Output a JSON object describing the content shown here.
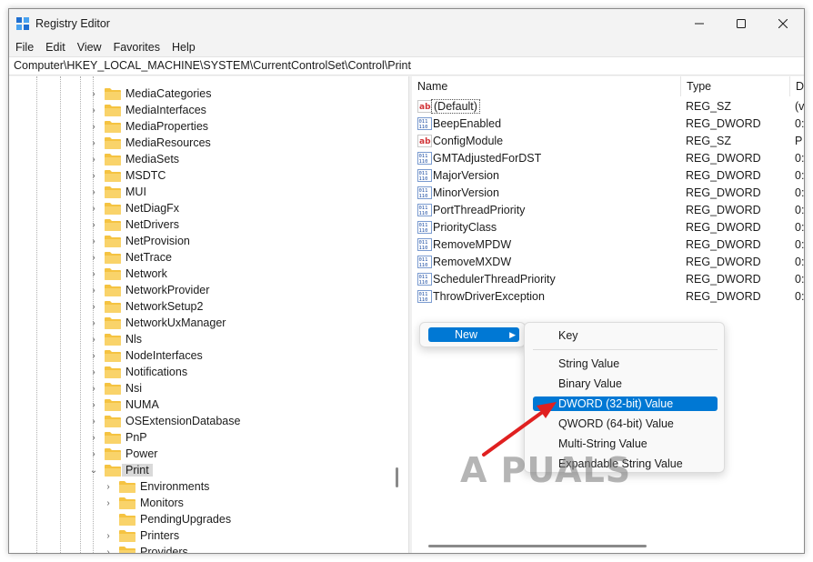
{
  "window": {
    "title": "Registry Editor"
  },
  "menu": [
    "File",
    "Edit",
    "View",
    "Favorites",
    "Help"
  ],
  "address": "Computer\\HKEY_LOCAL_MACHINE\\SYSTEM\\CurrentControlSet\\Control\\Print",
  "tree": {
    "items": [
      "MediaCategories",
      "MediaInterfaces",
      "MediaProperties",
      "MediaResources",
      "MediaSets",
      "MSDTC",
      "MUI",
      "NetDiagFx",
      "NetDrivers",
      "NetProvision",
      "NetTrace",
      "Network",
      "NetworkProvider",
      "NetworkSetup2",
      "NetworkUxManager",
      "Nls",
      "NodeInterfaces",
      "Notifications",
      "Nsi",
      "NUMA",
      "OSExtensionDatabase",
      "PnP",
      "Power",
      "Print"
    ],
    "selected": "Print",
    "children": [
      "Environments",
      "Monitors",
      "PendingUpgrades",
      "Printers",
      "Providers"
    ]
  },
  "list": {
    "columns": [
      "Name",
      "Type",
      "Data"
    ],
    "rows": [
      {
        "name": "(Default)",
        "type": "REG_SZ",
        "data": "(v",
        "icon": "string-value-icon"
      },
      {
        "name": "BeepEnabled",
        "type": "REG_DWORD",
        "data": "0:",
        "icon": "binary-value-icon"
      },
      {
        "name": "ConfigModule",
        "type": "REG_SZ",
        "data": "P",
        "icon": "string-value-icon"
      },
      {
        "name": "GMTAdjustedForDST",
        "type": "REG_DWORD",
        "data": "0:",
        "icon": "binary-value-icon"
      },
      {
        "name": "MajorVersion",
        "type": "REG_DWORD",
        "data": "0:",
        "icon": "binary-value-icon"
      },
      {
        "name": "MinorVersion",
        "type": "REG_DWORD",
        "data": "0:",
        "icon": "binary-value-icon"
      },
      {
        "name": "PortThreadPriority",
        "type": "REG_DWORD",
        "data": "0:",
        "icon": "binary-value-icon"
      },
      {
        "name": "PriorityClass",
        "type": "REG_DWORD",
        "data": "0:",
        "icon": "binary-value-icon"
      },
      {
        "name": "RemoveMPDW",
        "type": "REG_DWORD",
        "data": "0:",
        "icon": "binary-value-icon"
      },
      {
        "name": "RemoveMXDW",
        "type": "REG_DWORD",
        "data": "0:",
        "icon": "binary-value-icon"
      },
      {
        "name": "SchedulerThreadPriority",
        "type": "REG_DWORD",
        "data": "0:",
        "icon": "binary-value-icon"
      },
      {
        "name": "ThrowDriverException",
        "type": "REG_DWORD",
        "data": "0:",
        "icon": "binary-value-icon"
      }
    ]
  },
  "context_menu": {
    "new_label": "New",
    "submenu": {
      "key": "Key",
      "string": "String Value",
      "binary": "Binary Value",
      "dword": "DWORD (32-bit) Value",
      "qword": "QWORD (64-bit) Value",
      "multi": "Multi-String Value",
      "expandable": "Expandable String Value"
    },
    "highlighted": "DWORD (32-bit) Value"
  },
  "watermark": "A  PUALS",
  "colors": {
    "accent": "#0078d4",
    "annotation_arrow": "#e02020",
    "folder": "#f5c341"
  }
}
